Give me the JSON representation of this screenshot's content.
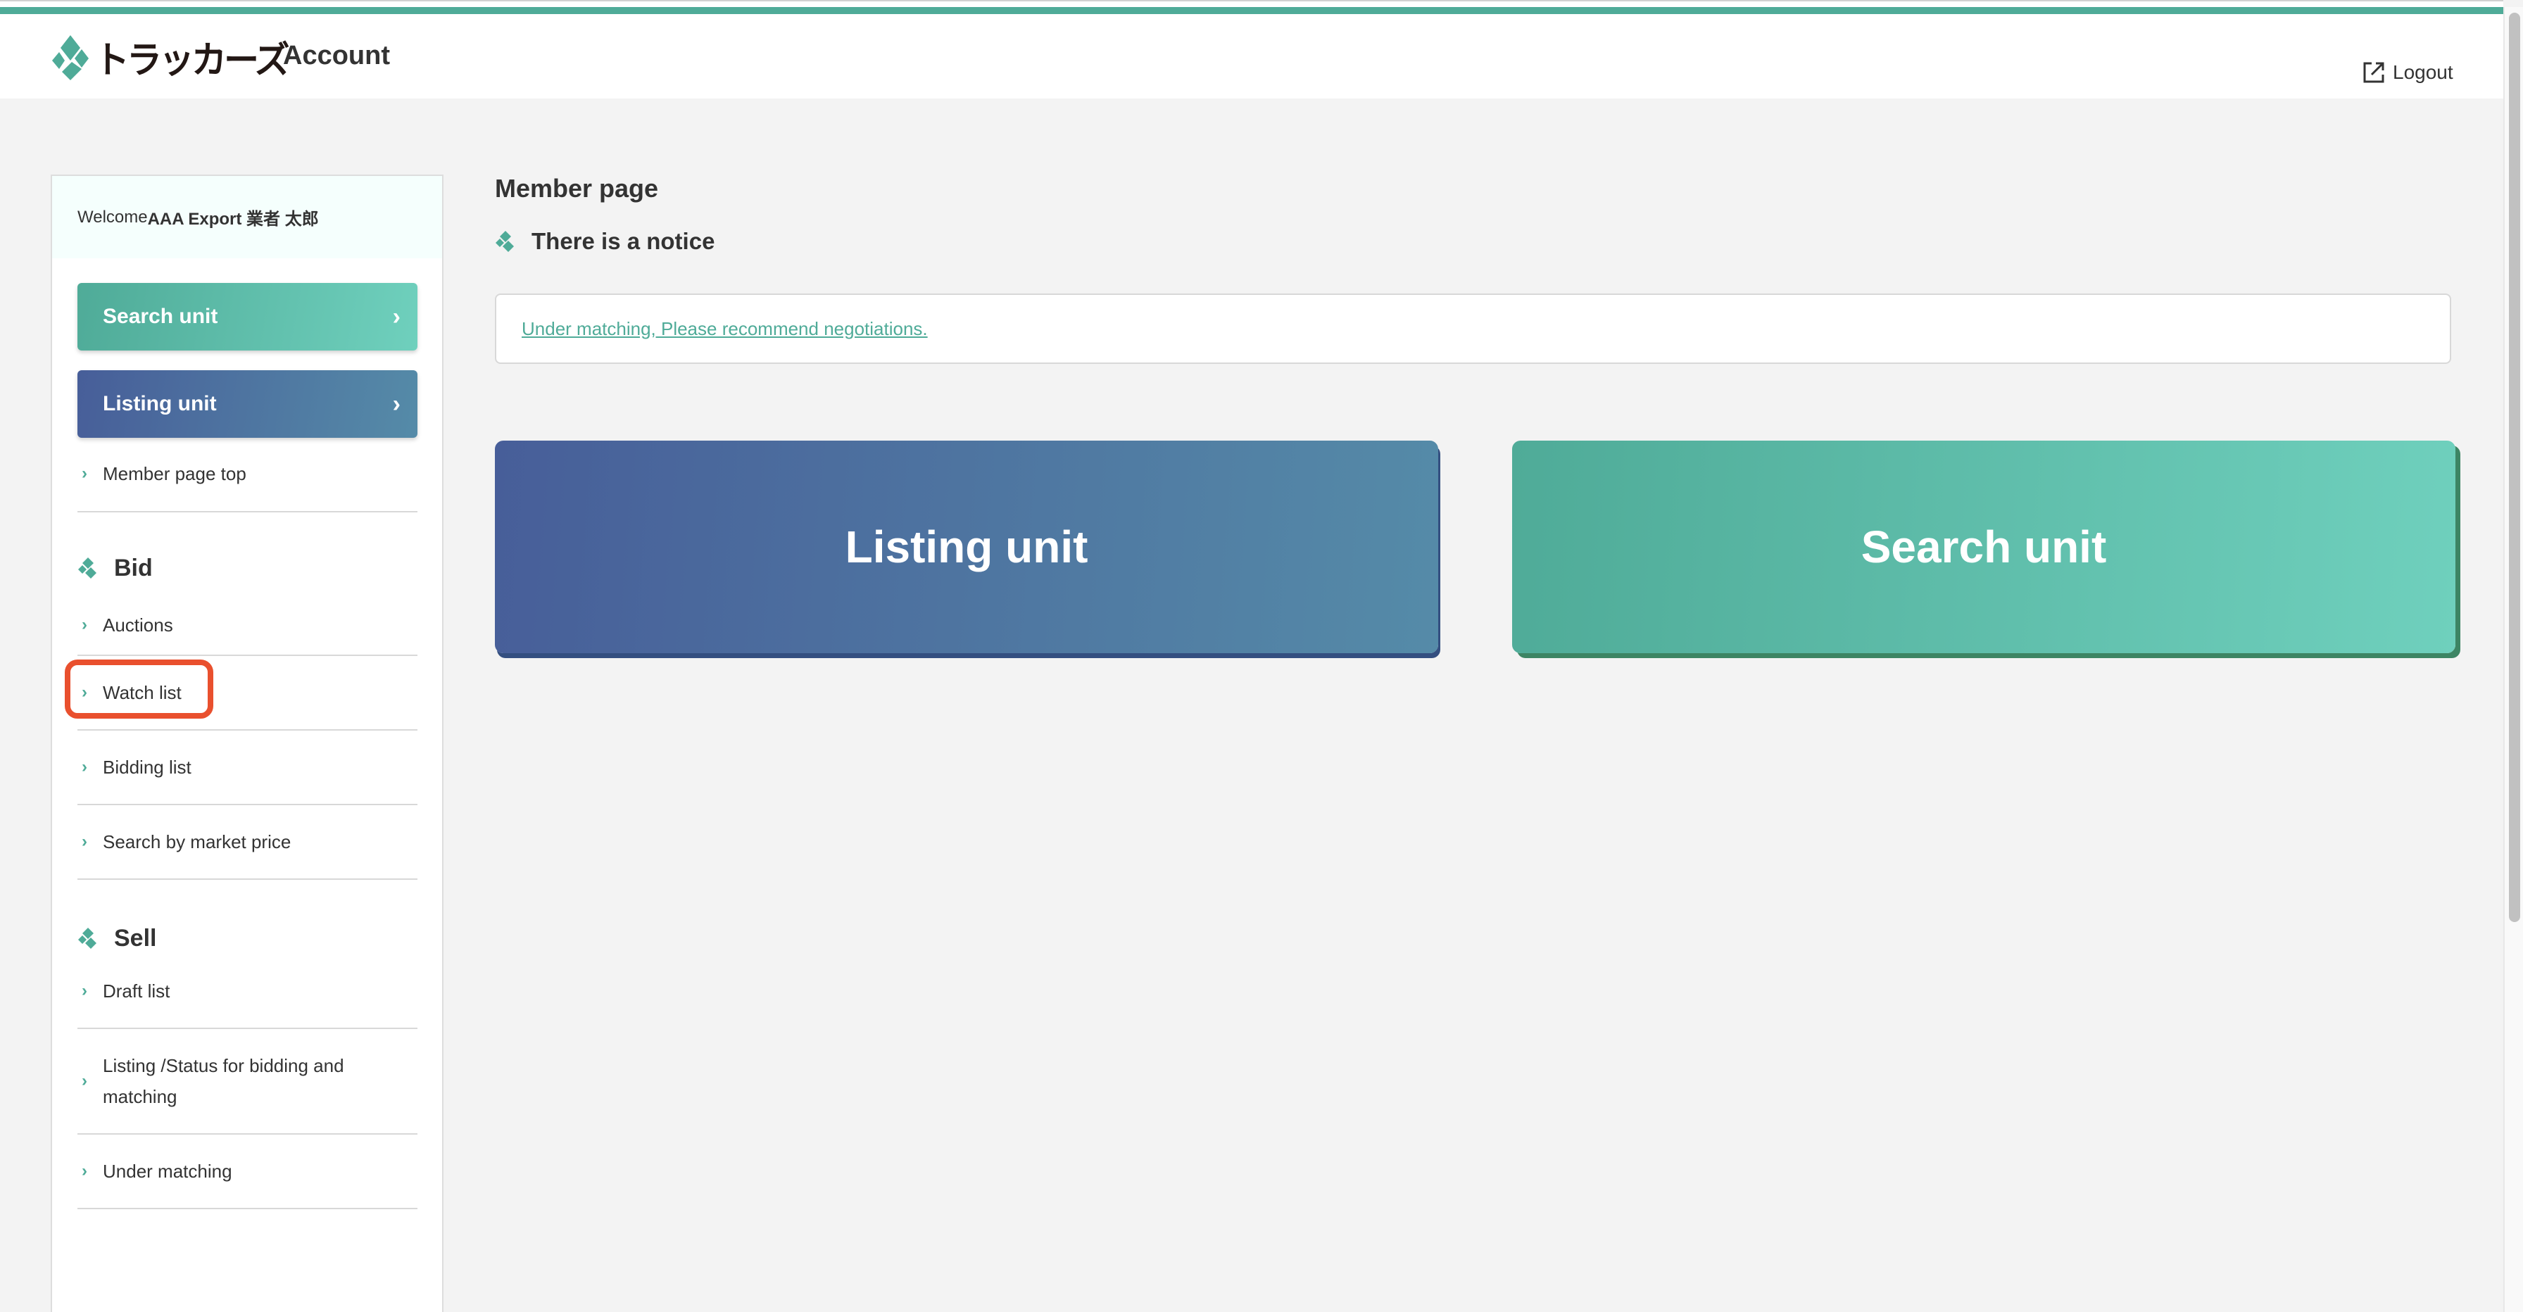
{
  "header": {
    "logo_text": "トラッカーズ",
    "title": "Account",
    "logout_label": "Logout"
  },
  "sidebar": {
    "welcome_prefix": "Welcome",
    "welcome_user": "AAA Export 業者 太郎",
    "buttons": [
      {
        "label": "Search unit",
        "icon": "chevron-right"
      },
      {
        "label": "Listing unit",
        "icon": "chevron-right"
      }
    ],
    "top_items": [
      {
        "label": "Member page top"
      }
    ],
    "sections": [
      {
        "heading": "Bid",
        "items": [
          {
            "label": "Auctions",
            "highlighted": true
          },
          {
            "label": "Watch list"
          },
          {
            "label": "Bidding list"
          },
          {
            "label": "Search by market price"
          }
        ]
      },
      {
        "heading": "Sell",
        "items": [
          {
            "label": "Draft list"
          },
          {
            "label": "Listing /Status for bidding and matching"
          },
          {
            "label": "Under matching"
          }
        ]
      }
    ]
  },
  "main": {
    "page_title": "Member page",
    "notice_heading": "There is a notice",
    "notice_link": "Under matching, Please recommend negotiations.",
    "big_buttons": [
      {
        "label": "Listing unit"
      },
      {
        "label": "Search unit"
      }
    ]
  },
  "colors": {
    "accent": "#4fab98",
    "listing_gradient_start": "#475e99",
    "listing_gradient_end": "#558ba8",
    "search_gradient_start": "#4fab98",
    "search_gradient_end": "#6fd0bd",
    "highlight": "#e9502e"
  }
}
